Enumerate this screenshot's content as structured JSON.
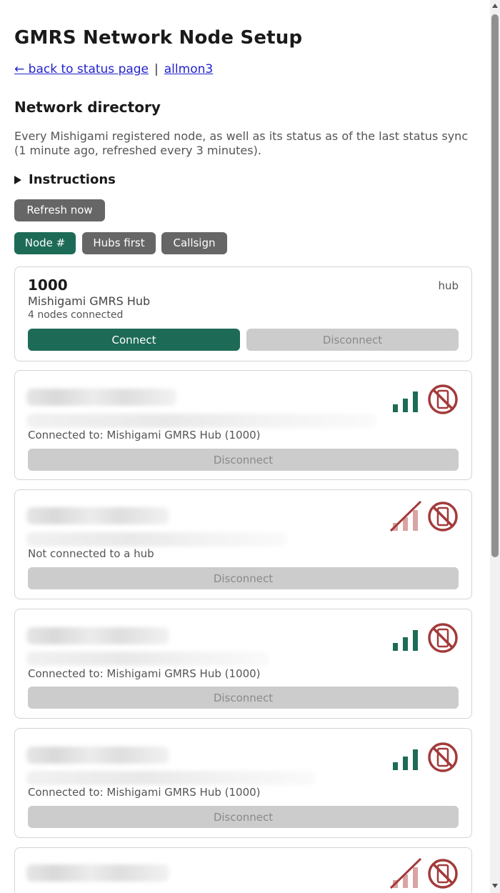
{
  "header": {
    "title": "GMRS Network Node Setup",
    "back_link": "← back to status page",
    "separator": "|",
    "allmon_link": "allmon3"
  },
  "directory": {
    "heading": "Network directory",
    "description": "Every Mishigami registered node, as well as its status as of the last status sync (1 minute ago, refreshed every 3 minutes).",
    "instructions_label": "Instructions",
    "refresh_label": "Refresh now"
  },
  "sort": {
    "node_label": "Node #",
    "hubs_label": "Hubs first",
    "callsign_label": "Callsign"
  },
  "hub": {
    "number": "1000",
    "tag": "hub",
    "name": "Mishigami GMRS Hub",
    "count": "4 nodes connected",
    "connect_label": "Connect",
    "disconnect_label": "Disconnect"
  },
  "nodes": [
    {
      "status": "Connected to: Mishigami GMRS Hub (1000)",
      "disconnect_label": "Disconnect",
      "signal": "signal-bars-icon"
    },
    {
      "status": "Not connected to a hub",
      "disconnect_label": "Disconnect",
      "signal": "signal-off-icon"
    },
    {
      "status": "Connected to: Mishigami GMRS Hub (1000)",
      "disconnect_label": "Disconnect",
      "signal": "signal-bars-icon"
    },
    {
      "status": "Connected to: Mishigami GMRS Hub (1000)",
      "disconnect_label": "Disconnect",
      "signal": "signal-bars-icon"
    },
    {
      "signal": "signal-off-icon"
    }
  ],
  "colors": {
    "accent": "#1d6b57",
    "muted_button": "#666666",
    "disabled_button": "#cccccc",
    "warning_red": "#a33a3a"
  }
}
